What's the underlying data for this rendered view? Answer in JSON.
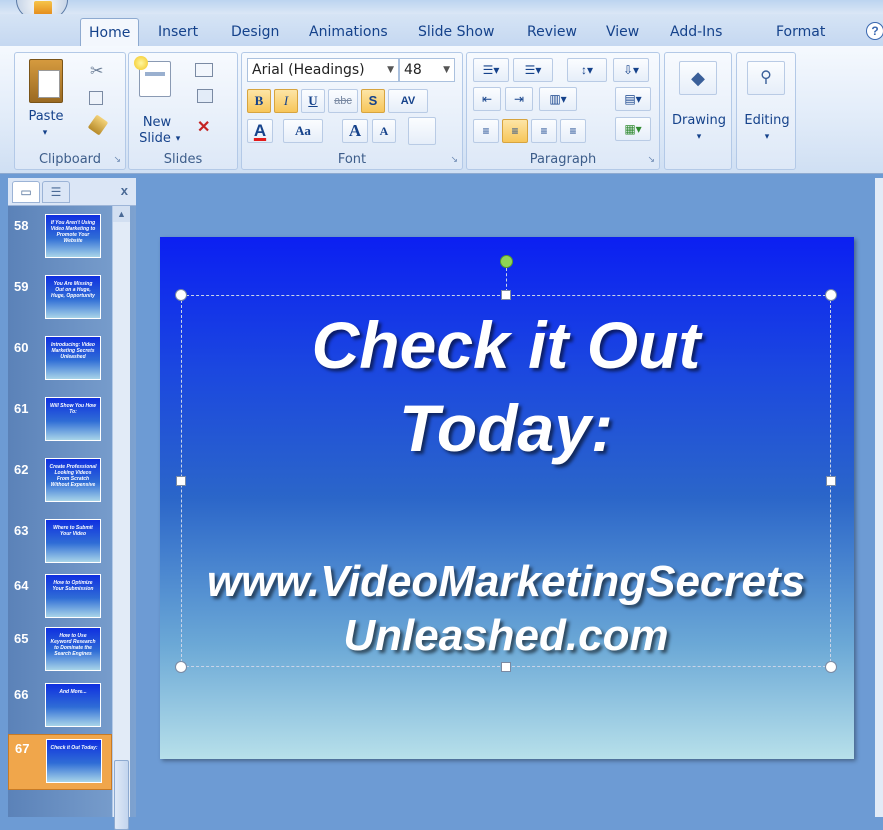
{
  "ribbon": {
    "tabs": [
      {
        "label": "Home"
      },
      {
        "label": "Insert"
      },
      {
        "label": "Design"
      },
      {
        "label": "Animations"
      },
      {
        "label": "Slide Show"
      },
      {
        "label": "Review"
      },
      {
        "label": "View"
      },
      {
        "label": "Add-Ins"
      },
      {
        "label": "Format"
      }
    ],
    "clipboard": {
      "group_label": "Clipboard",
      "paste_label": "Paste"
    },
    "slides": {
      "group_label": "Slides",
      "new_slide_line1": "New",
      "new_slide_line2": "Slide"
    },
    "font": {
      "group_label": "Font",
      "font_name": "Arial (Headings)",
      "font_size": "48",
      "bold": "B",
      "italic": "I",
      "underline": "U",
      "strike": "abc",
      "shadow": "S",
      "spacing": "AV",
      "font_color": "A",
      "change_case": "Aa",
      "grow": "A",
      "shrink": "A"
    },
    "paragraph": {
      "group_label": "Paragraph"
    },
    "drawing": {
      "label": "Drawing"
    },
    "editing": {
      "label": "Editing"
    }
  },
  "panel": {
    "close": "x",
    "thumbnails": [
      {
        "number": "58",
        "text": "If You Aren't Using Video Marketing to Promote Your Website"
      },
      {
        "number": "59",
        "text": "You Are Missing Out on a Huge, Huge, Opportunity"
      },
      {
        "number": "60",
        "text": "Introducing: Video Marketing Secrets Unleashed"
      },
      {
        "number": "61",
        "text": "Will Show You How To:"
      },
      {
        "number": "62",
        "text": "Create Professional Looking Videos From Scratch Without Expensive"
      },
      {
        "number": "63",
        "text": "Where to Submit Your Video"
      },
      {
        "number": "64",
        "text": "How to Optimize Your Submission"
      },
      {
        "number": "65",
        "text": "How to Use Keyword Research to Dominate the Search Engines"
      },
      {
        "number": "66",
        "text": "And More..."
      },
      {
        "number": "67",
        "text": "Check it Out Today:"
      }
    ]
  },
  "slide": {
    "title_line1": "Check it Out",
    "title_line2": "Today:",
    "url_line1": "www.VideoMarketingSecrets",
    "url_line2": "Unleashed.com"
  },
  "colors": {
    "slide_top": "#0b1ff2",
    "slide_bottom": "#b7e0ea",
    "selected_thumb": "#f0a64b"
  }
}
